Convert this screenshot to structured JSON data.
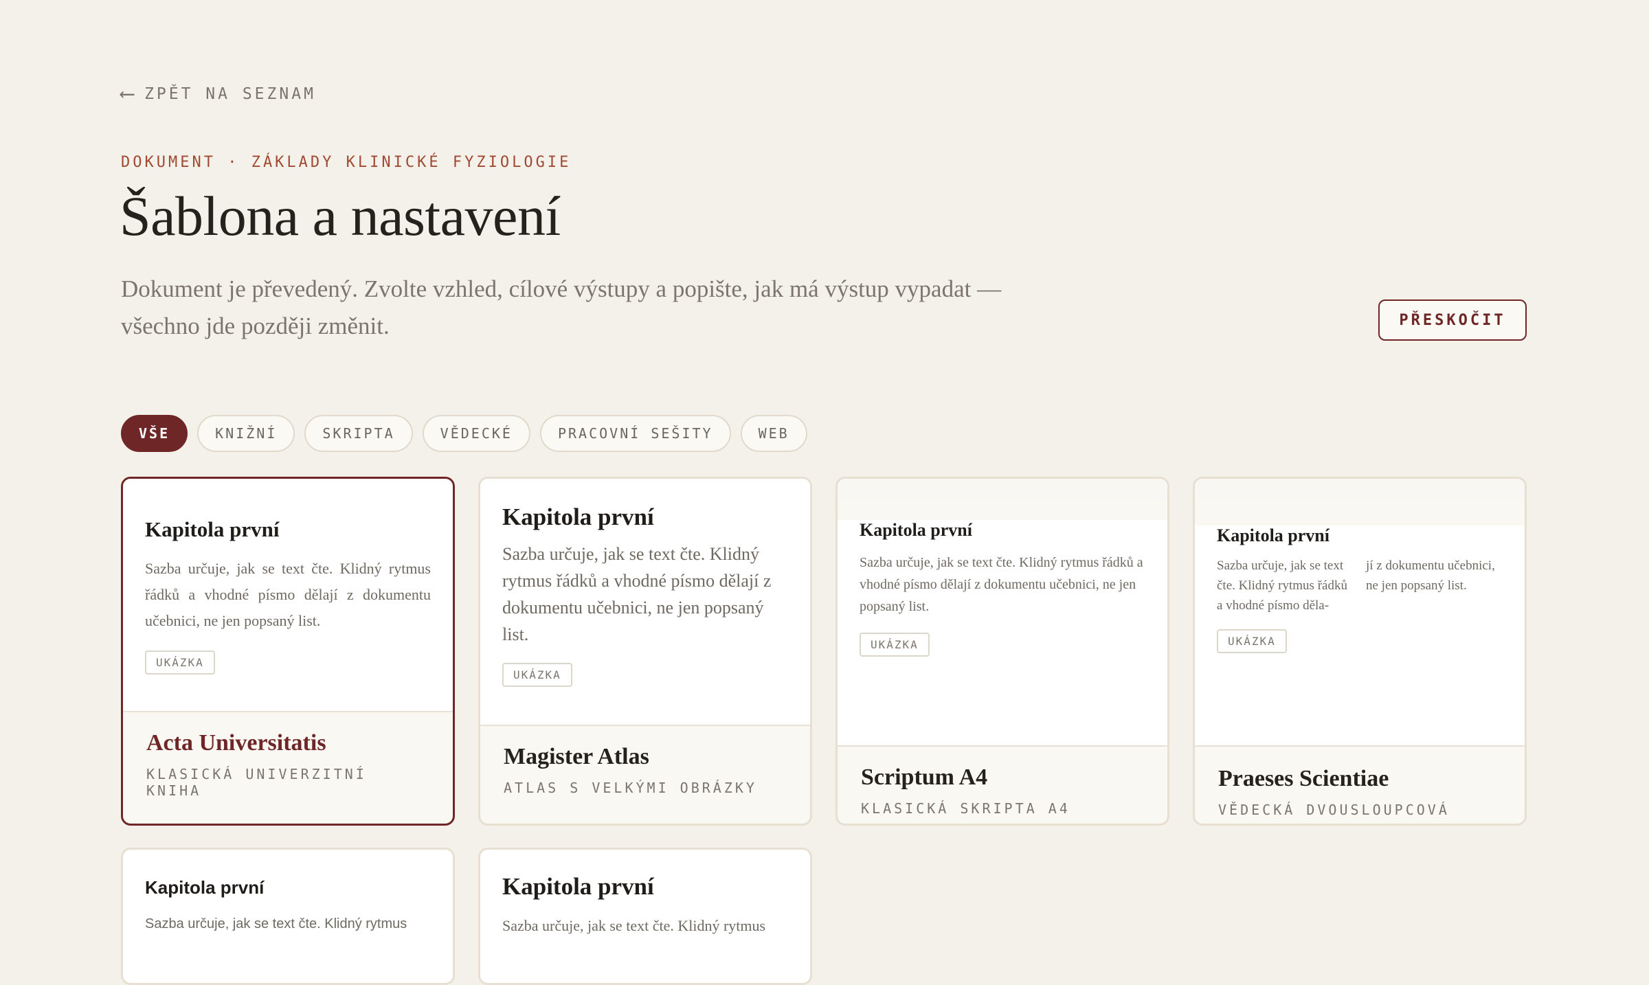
{
  "nav": {
    "back_arrow": "⟵",
    "back_label": "ZPĚT NA SEZNAM"
  },
  "header": {
    "eyebrow": "DOKUMENT · ZÁKLADY KLINICKÉ FYZIOLOGIE",
    "title": "Šablona a nastavení",
    "subtitle": "Dokument je převedený. Zvolte vzhled, cílové výstupy a popište, jak má výstup vypadat — všechno jde později změnit.",
    "skip_label": "PŘESKOČIT"
  },
  "filters": [
    {
      "label": "VŠE",
      "active": true
    },
    {
      "label": "KNIŽNÍ"
    },
    {
      "label": "SKRIPTA"
    },
    {
      "label": "VĚDECKÉ"
    },
    {
      "label": "PRACOVNÍ SEŠITY"
    },
    {
      "label": "WEB"
    }
  ],
  "accent_color": "#6e2626",
  "templates": [
    {
      "selected": true,
      "preview_title": "Kapitola první",
      "preview_body": "Sazba určuje, jak se text čte. Klidný rytmus řádků a vhodné písmo dělají z dokumentu učebnici, ne jen popsaný list.",
      "tag": "UKÁZKA",
      "name": "Acta Universitatis",
      "subtitle": "KLASICKÁ UNIVERZITNÍ KNIHA"
    },
    {
      "preview_title": "Kapitola první",
      "preview_body": "Sazba určuje, jak se text čte. Klidný rytmus řádků a vhodné písmo dělají z dokumentu učebnici, ne jen popsaný list.",
      "tag": "UKÁZKA",
      "name": "Magister Atlas",
      "subtitle": "ATLAS S VELKÝMI OBRÁZKY"
    },
    {
      "preview_title": "Kapitola první",
      "preview_body": "Sazba určuje, jak se text čte. Klidný rytmus řád­ků a vhodné písmo dělají z dokumentu učebni­ci, ne jen popsaný list.",
      "tag": "UKÁZKA",
      "name": "Scriptum A4",
      "subtitle": "KLASICKÁ SKRIPTA A4"
    },
    {
      "preview_title": "Kapitola první",
      "preview_col1": "Sazba určuje, jak se text čte. Klidný rytmus řád­ků a vhodné písmo děla-",
      "preview_col2": "jí z dokumentu učebnici, ne jen popsaný list.",
      "tag": "UKÁZKA",
      "name": "Praeses Scientiae",
      "subtitle": "VĚDECKÁ DVOUSLOUPCOVÁ"
    },
    {
      "preview_title": "Kapitola první",
      "preview_body": "Sazba určuje, jak se text čte. Klidný rytmus"
    },
    {
      "preview_title": "Kapitola první",
      "preview_body": "Sazba určuje, jak se text čte. Klidný rytmus"
    }
  ]
}
